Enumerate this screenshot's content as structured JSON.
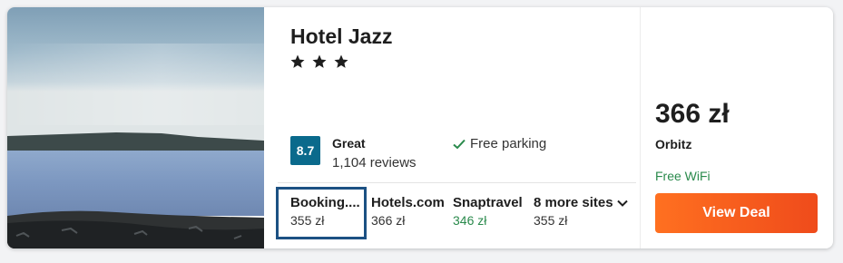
{
  "hotel": {
    "name": "Hotel Jazz",
    "star_count": 3,
    "score": "8.7",
    "rating_label": "Great",
    "reviews": "1,104 reviews",
    "amenity": "Free parking"
  },
  "sites": [
    {
      "name": "Booking.com",
      "display_name": "Booking....",
      "price": "355 zł",
      "highlighted": true
    },
    {
      "name": "Hotels.com",
      "price": "366 zł"
    },
    {
      "name": "Snaptravel",
      "price": "346 zł",
      "best_price": true
    },
    {
      "name": "8 more sites",
      "price": "355 zł"
    }
  ],
  "deal": {
    "price": "366 zł",
    "site": "Orbitz",
    "perk": "Free WiFi",
    "button_label": "View Deal"
  },
  "colors": {
    "score_bg": "#0a6a8c",
    "green": "#2a8a4c",
    "button": "#ff6a1f",
    "highlight_border": "#1c5183"
  },
  "icons": {
    "star": "star-icon",
    "check": "check-icon",
    "chevron": "chevron-down-icon"
  }
}
